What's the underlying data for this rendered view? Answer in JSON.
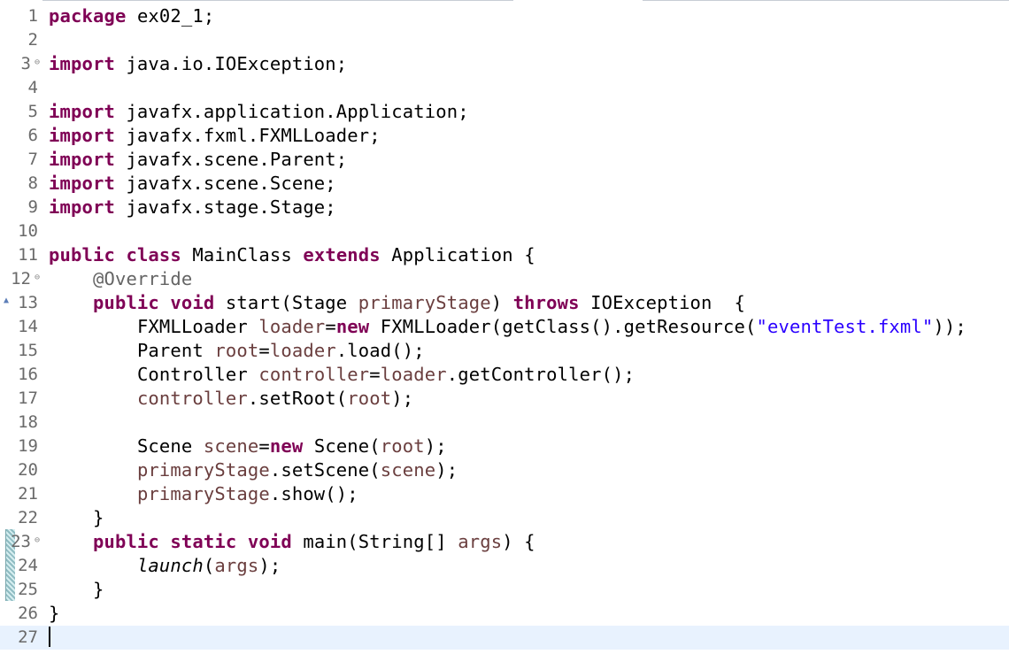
{
  "editor": {
    "line_numbers": [
      "1",
      "2",
      "3",
      "4",
      "5",
      "6",
      "7",
      "8",
      "9",
      "10",
      "11",
      "12",
      "13",
      "14",
      "15",
      "16",
      "17",
      "18",
      "19",
      "20",
      "21",
      "22",
      "23",
      "24",
      "25",
      "26",
      "27"
    ],
    "code": {
      "l1_kw": "package",
      "l1_rest": " ex02_1;",
      "l3_kw": "import",
      "l3_rest": " java.io.IOException;",
      "l5_kw": "import",
      "l5_rest": " javafx.application.Application;",
      "l6_kw": "import",
      "l6_rest": " javafx.fxml.FXMLLoader;",
      "l7_kw": "import",
      "l7_rest": " javafx.scene.Parent;",
      "l8_kw": "import",
      "l8_rest": " javafx.scene.Scene;",
      "l9_kw": "import",
      "l9_rest": " javafx.stage.Stage;",
      "l11_kw1": "public",
      "l11_kw2": "class",
      "l11_name": " MainClass ",
      "l11_kw3": "extends",
      "l11_rest": " Application {",
      "l12_ann": "@Override",
      "l13_kw1": "public",
      "l13_kw2": "void",
      "l13_a": " start(Stage ",
      "l13_var": "primaryStage",
      "l13_b": ") ",
      "l13_kw3": "throws",
      "l13_c": " IOException  {",
      "l14_a": "FXMLLoader ",
      "l14_var": "loader",
      "l14_eq": "=",
      "l14_kw": "new",
      "l14_b": " FXMLLoader(getClass().getResource(",
      "l14_str": "\"eventTest.fxml\"",
      "l14_c": "));",
      "l15_a": "Parent ",
      "l15_var1": "root",
      "l15_eq": "=",
      "l15_var2": "loader",
      "l15_b": ".load();",
      "l16_a": "Controller ",
      "l16_var1": "controller",
      "l16_eq": "=",
      "l16_var2": "loader",
      "l16_b": ".getController();",
      "l17_var1": "controller",
      "l17_a": ".setRoot(",
      "l17_var2": "root",
      "l17_b": ");",
      "l19_a": "Scene ",
      "l19_var1": "scene",
      "l19_eq": "=",
      "l19_kw": "new",
      "l19_b": " Scene(",
      "l19_var2": "root",
      "l19_c": ");",
      "l20_var1": "primaryStage",
      "l20_a": ".setScene(",
      "l20_var2": "scene",
      "l20_b": ");",
      "l21_var": "primaryStage",
      "l21_a": ".show();",
      "l22": "}",
      "l23_kw1": "public",
      "l23_kw2": "static",
      "l23_kw3": "void",
      "l23_a": " main(String[] ",
      "l23_var": "args",
      "l23_b": ") {",
      "l24_stat": "launch",
      "l24_a": "(",
      "l24_var": "args",
      "l24_b": ");",
      "l25": "}",
      "l26": "}"
    },
    "colors": {
      "keyword": "#7f0055",
      "variable": "#6a3e3e",
      "string": "#2a00ff",
      "annotation": "#646464",
      "current_line": "#e8f2fe"
    }
  }
}
